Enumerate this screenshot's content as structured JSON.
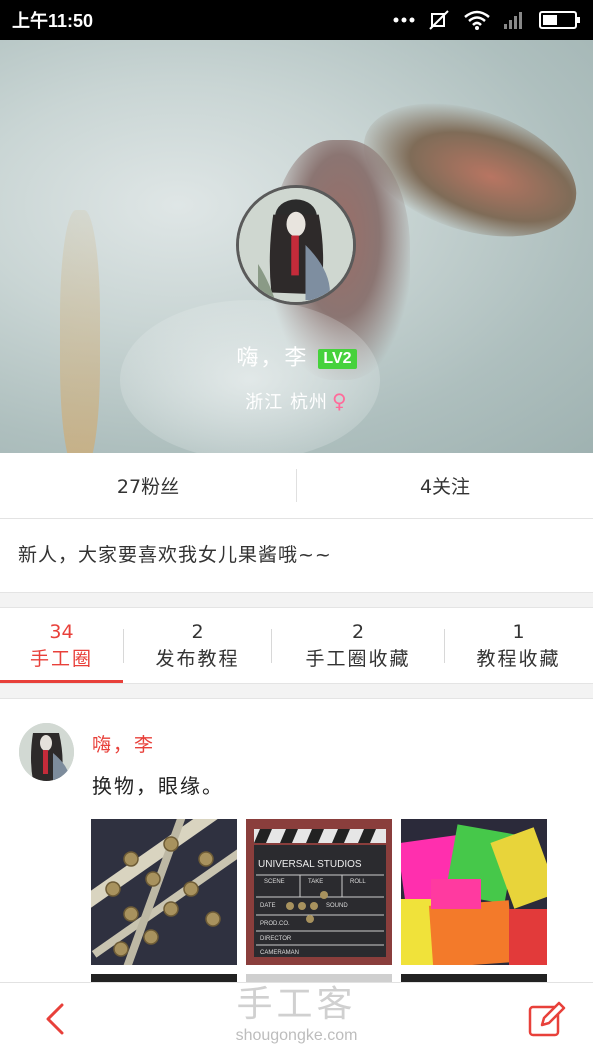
{
  "status_bar": {
    "time": "上午11:50",
    "icons": [
      "more-dots-icon",
      "mute-icon",
      "wifi-icon",
      "signal-icon",
      "battery-icon"
    ]
  },
  "profile": {
    "name": "嗨，李",
    "level": "LV2",
    "location": "浙江 杭州",
    "gender_symbol": "♀",
    "followers": "27粉丝",
    "following": "4关注",
    "bio": "新人，大家要喜欢我女儿果酱哦~~"
  },
  "tabs": [
    {
      "count": "34",
      "label": "手工圈",
      "active": true
    },
    {
      "count": "2",
      "label": "发布教程",
      "active": false
    },
    {
      "count": "2",
      "label": "手工圈收藏",
      "active": false
    },
    {
      "count": "1",
      "label": "教程收藏",
      "active": false
    }
  ],
  "post": {
    "author": "嗨，李",
    "text": "换物，眼缘。",
    "clapper_top": "UNIVERSAL STUDIOS",
    "clapper_scene": "SCENE",
    "clapper_take": "TAKE",
    "clapper_roll": "ROLL",
    "clapper_date": "DATE",
    "clapper_sound": "SOUND",
    "clapper_prod": "PROD.CO.",
    "clapper_director": "DIRECTOR",
    "clapper_camera": "CAMERAMAN"
  },
  "watermark": {
    "logo": "手工客",
    "url": "shougongke.com"
  },
  "colors": {
    "accent": "#e8403a",
    "level_badge": "#46d23c",
    "gender": "#ff6b9a"
  }
}
